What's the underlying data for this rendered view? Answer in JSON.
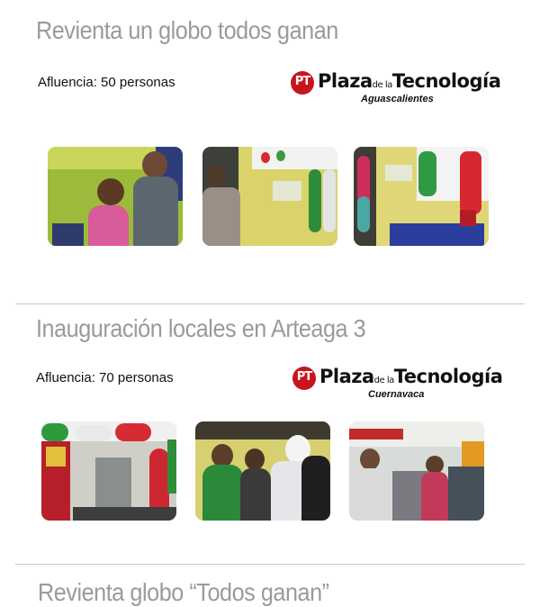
{
  "events": [
    {
      "title": "Revienta un globo todos ganan",
      "attendance": "Afluencia: 50 personas",
      "logo": {
        "badge": "PT",
        "brand_a": "Plaza",
        "brand_small": "de la",
        "brand_b": "Tecnología",
        "city": "Aguascalientes"
      }
    },
    {
      "title": "Inauguración locales en Arteaga 3",
      "attendance": "Afluencia: 70 personas",
      "logo": {
        "badge": "PT",
        "brand_a": "Plaza",
        "brand_small": "de la",
        "brand_b": "Tecnología",
        "city": "Cuernavaca"
      }
    },
    {
      "title": "Revienta globo “Todos ganan”"
    }
  ],
  "colors": {
    "title": "#9a9a9a",
    "brand_red": "#c8151b",
    "divider": "#c9c9c9"
  }
}
